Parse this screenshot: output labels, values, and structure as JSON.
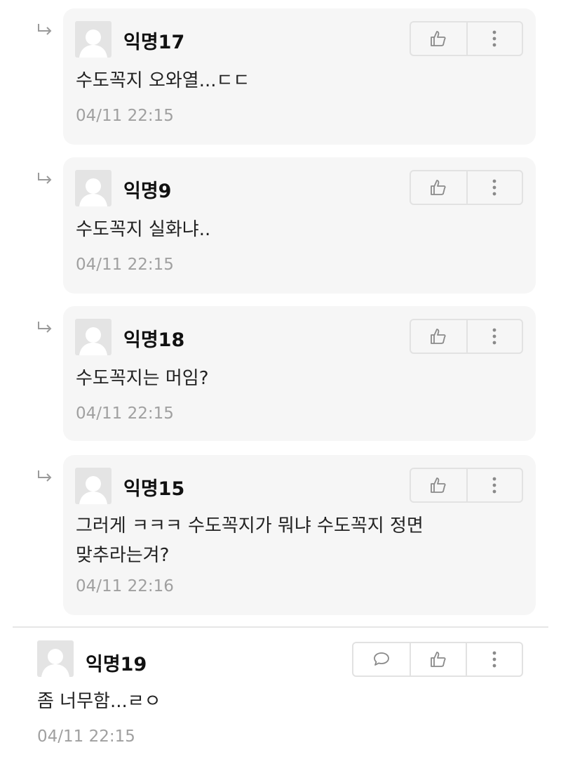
{
  "replies": [
    {
      "author": "익명17",
      "content": "수도꼭지 오와열...ㄷㄷ",
      "time": "04/11 22:15"
    },
    {
      "author": "익명9",
      "content": "수도꼭지 실화냐..",
      "time": "04/11 22:15"
    },
    {
      "author": "익명18",
      "content": "수도꼭지는 머임?",
      "time": "04/11 22:15"
    },
    {
      "author": "익명15",
      "content": "그러게 ㅋㅋㅋ 수도꼭지가 뭐냐 수도꼭지 정면\n맞추라는겨?",
      "time": "04/11 22:16"
    }
  ],
  "comment": {
    "author": "익명19",
    "content": "좀 너무함...ㄹㅇ",
    "time": "04/11 22:15"
  },
  "icons": {
    "reply_arrow": "reply-arrow-icon",
    "like": "thumbs-up-icon",
    "more": "more-vertical-icon",
    "reply": "speech-bubble-icon",
    "avatar": "default-avatar-icon"
  },
  "colors": {
    "card_background": "#f6f6f6",
    "timestamp": "#a0a0a0",
    "button_border": "#e2e2e2",
    "icon": "#8a8a8a"
  }
}
